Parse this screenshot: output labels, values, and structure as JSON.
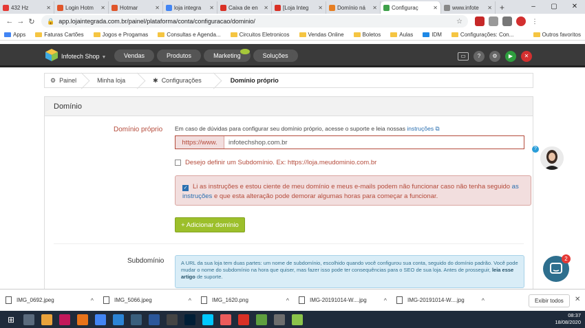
{
  "browser": {
    "tabs": [
      {
        "title": "432 Hz",
        "color": "#e53935"
      },
      {
        "title": "Login Hotm",
        "color": "#e0552a"
      },
      {
        "title": "Hotmar",
        "color": "#e0552a"
      },
      {
        "title": "loja integra",
        "color": "#4285f4"
      },
      {
        "title": "Caixa de en",
        "color": "#d93025"
      },
      {
        "title": "[Loja Integ",
        "color": "#d93025"
      },
      {
        "title": "Domínio ná",
        "color": "#e67e22"
      },
      {
        "title": "Configuraç",
        "color": "#3fa14a",
        "active": true
      },
      {
        "title": "www.infote",
        "color": "#888888"
      }
    ],
    "url": "app.lojaintegrada.com.br/painel/plataforma/conta/configuracao/dominio/",
    "bookmarks": [
      "Apps",
      "Faturas Cartões",
      "Jogos e Progamas",
      "Consultas e Agenda...",
      "Circuitos Eletronicos",
      "Vendas Online",
      "Boletos",
      "Aulas",
      "IDM",
      "Configurações: Con..."
    ],
    "other_bookmarks": "Outros favoritos"
  },
  "app": {
    "store_name": "Infotech Shop",
    "nav": [
      "Vendas",
      "Produtos",
      "Marketing",
      "Soluções"
    ],
    "header_icons": [
      {
        "name": "monitor-icon",
        "color": "#3a3a3a"
      },
      {
        "name": "help-icon",
        "color": "#666666"
      },
      {
        "name": "gear-icon",
        "color": "#666666"
      },
      {
        "name": "play-icon",
        "color": "#2e9e3e"
      },
      {
        "name": "close-icon",
        "color": "#d33030"
      }
    ]
  },
  "breadcrumb": [
    "Painel",
    "Minha loja",
    "Configurações",
    "Domínio próprio"
  ],
  "panel": {
    "title": "Domínio",
    "domain_label": "Domínio próprio",
    "help_text": "Em caso de dúvidas para configurar seu domínio próprio, acesse o suporte e leia nossas",
    "help_link": "instruções",
    "prefix": "https://www.",
    "domain_value": "infotechshop.com.br",
    "subdomain_check": "Desejo definir um Subdomínio. Ex: https://loja.meudominio.com.br",
    "alert_a": "Li as instruções e estou ciente de meu domínio e meus e-mails podem não funcionar caso não tenha seguido",
    "alert_link": "as instruções",
    "alert_b": "e que esta alteração pode demorar algumas horas para começar a funcionar.",
    "add_button": "+ Adicionar domínio",
    "subdomain_label": "Subdomínio",
    "info_text": "A URL da sua loja tem duas partes: um nome de subdomínio, escolhido quando você configurou sua conta, seguido do domínio padrão. Você pode mudar o nome do subdomínio na hora que quiser, mas fazer isso pode ter consequências para o SEO de sua loja. Antes de prosseguir,",
    "info_link": "leia esse artigo",
    "info_tail": "de suporte."
  },
  "chat_badge": "2",
  "downloads": [
    "IMG_0692.jpeg",
    "IMG_5066.jpeg",
    "IMG_1620.png",
    "IMG-20191014-W....jpg",
    "IMG-20191014-W....jpg"
  ],
  "downloads_all": "Exibir todos",
  "taskbar": {
    "time": "08:37",
    "date": "18/08/2020",
    "icons": [
      "#5b6b7d",
      "#e9a23b",
      "#c2185b",
      "#e8731a",
      "#4285f4",
      "#2b84d6",
      "#3a5f7d",
      "#2b579a",
      "#444444",
      "#001e36",
      "#00c8ff",
      "#ea5b5b",
      "#d93025",
      "#5e9e3e",
      "#6d6d6d",
      "#8bc34a"
    ]
  }
}
